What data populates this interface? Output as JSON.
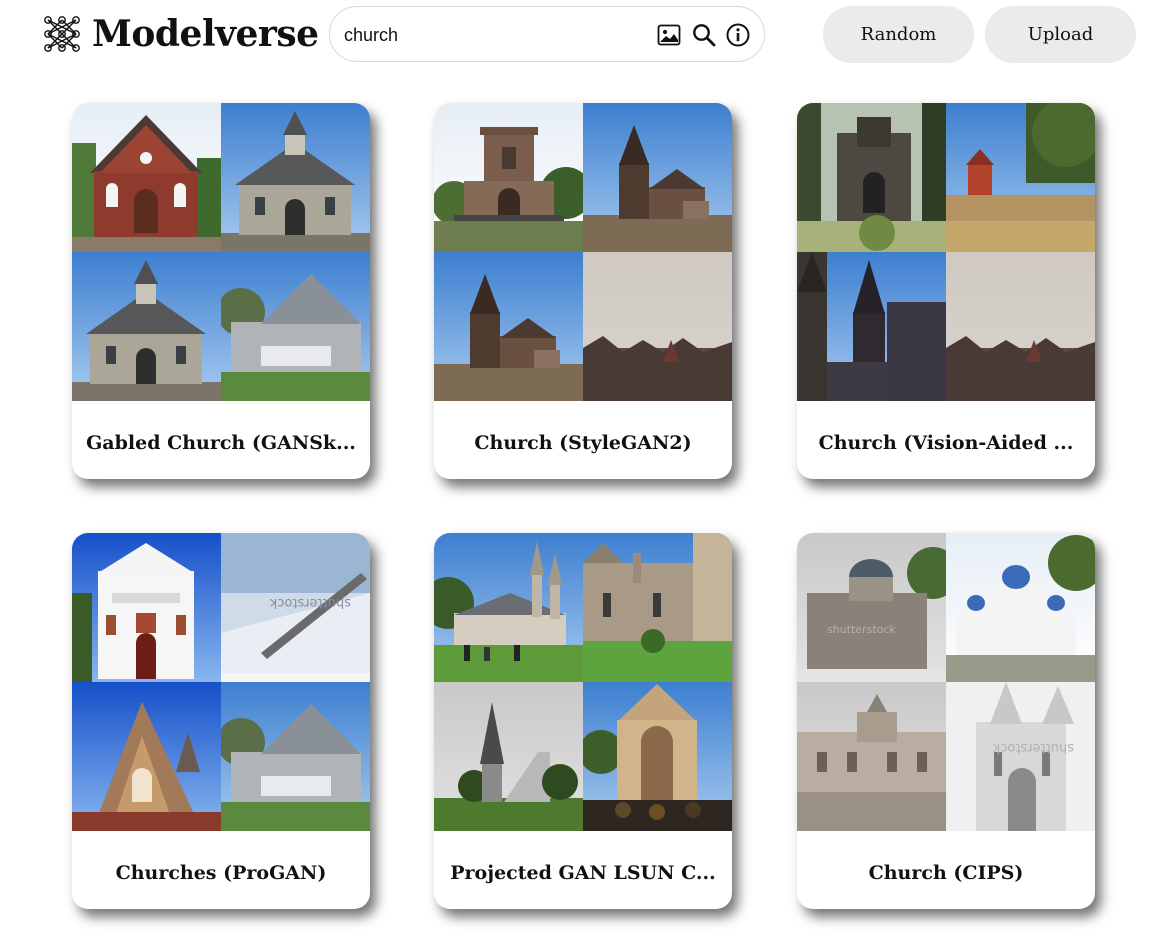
{
  "app": {
    "name": "Modelverse",
    "logo_icon": "network-grid-icon"
  },
  "search": {
    "value": "church",
    "icons": [
      "image-search-icon",
      "search-icon",
      "info-icon"
    ]
  },
  "actions": {
    "random_label": "Random",
    "upload_label": "Upload"
  },
  "colors": {
    "button_bg": "#ebebeb",
    "search_border": "#d8d8d8",
    "text": "#111111"
  },
  "cards": [
    {
      "title": "Gabled Church (GANSk..."
    },
    {
      "title": "Church (StyleGAN2)"
    },
    {
      "title": "Church (Vision-Aided ..."
    },
    {
      "title": "Churches (ProGAN)"
    },
    {
      "title": "Projected GAN LSUN C..."
    },
    {
      "title": "Church (CIPS)"
    }
  ]
}
